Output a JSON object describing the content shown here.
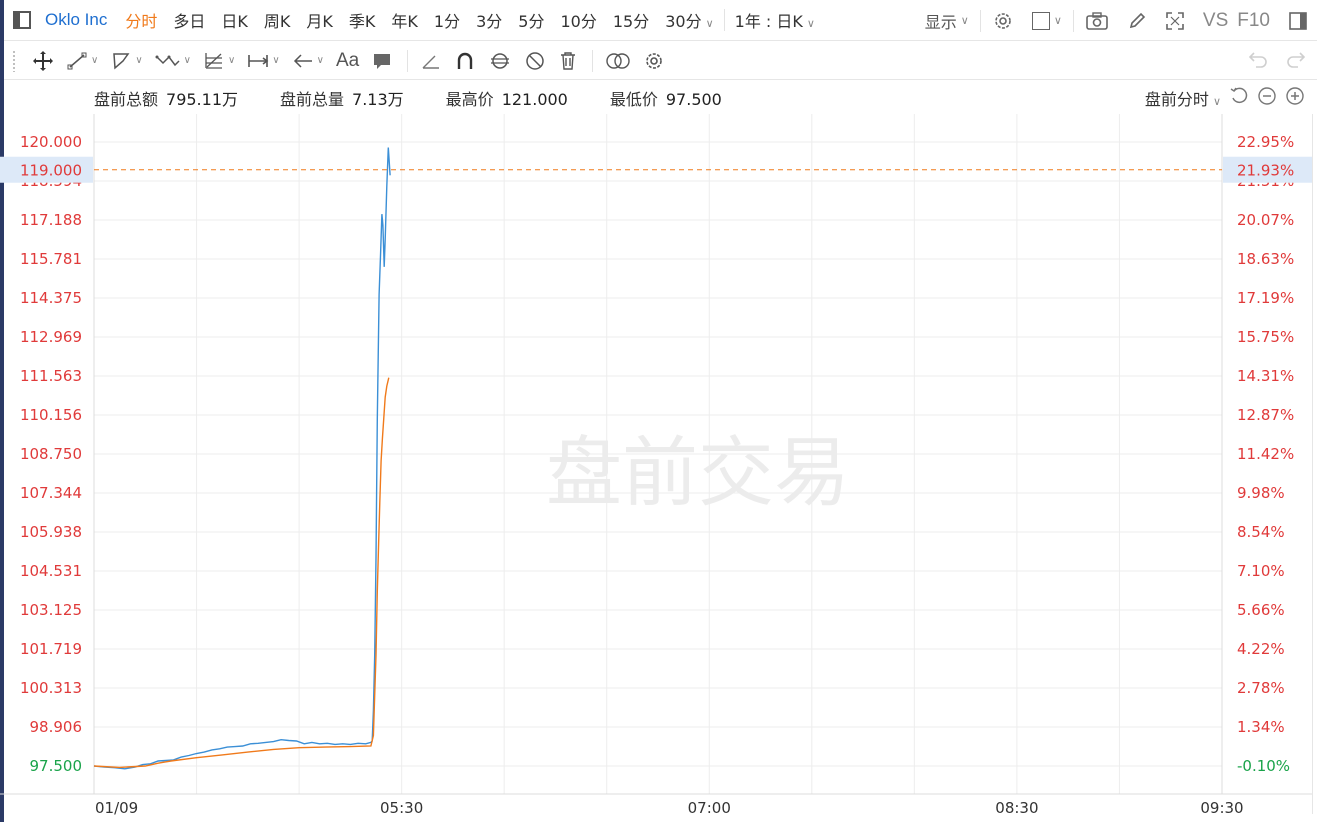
{
  "header": {
    "symbol": "Oklo Inc",
    "timeframes": [
      {
        "label": "分时",
        "active": true
      },
      {
        "label": "多日",
        "active": false
      },
      {
        "label": "日K",
        "active": false
      },
      {
        "label": "周K",
        "active": false
      },
      {
        "label": "月K",
        "active": false
      },
      {
        "label": "季K",
        "active": false
      },
      {
        "label": "年K",
        "active": false
      },
      {
        "label": "1分",
        "active": false
      },
      {
        "label": "3分",
        "active": false
      },
      {
        "label": "5分",
        "active": false
      },
      {
        "label": "10分",
        "active": false
      },
      {
        "label": "15分",
        "active": false
      }
    ],
    "dropdown_interval": "30分",
    "period_select": "1年 : 日K",
    "display_label": "显示",
    "vs_label": "VS",
    "f10_label": "F10"
  },
  "drawing_toolbar": {
    "text_tool": "Aa"
  },
  "stats": {
    "premarket_amount_label": "盘前总额",
    "premarket_amount": "795.11万",
    "premarket_volume_label": "盘前总量",
    "premarket_volume": "7.13万",
    "high_label": "最高价",
    "high": "121.000",
    "low_label": "最低价",
    "low": "97.500",
    "mode_select": "盘前分时"
  },
  "chart_data": {
    "type": "line",
    "watermark": "盘前交易",
    "x_ticks": [
      "01/09",
      "05:30",
      "07:00",
      "08:30",
      "09:30"
    ],
    "left_ticks": [
      "120.000",
      "118.594",
      "117.188",
      "115.781",
      "114.375",
      "112.969",
      "111.563",
      "110.156",
      "108.750",
      "107.344",
      "105.938",
      "104.531",
      "103.125",
      "101.719",
      "100.313",
      "98.906",
      "97.500"
    ],
    "right_ticks": [
      "22.95%",
      "21.51%",
      "20.07%",
      "18.63%",
      "17.19%",
      "15.75%",
      "14.31%",
      "12.87%",
      "11.42%",
      "9.98%",
      "8.54%",
      "7.10%",
      "5.66%",
      "4.22%",
      "2.78%",
      "1.34%",
      "-0.10%"
    ],
    "ylim": [
      97.5,
      120.0
    ],
    "crosshair_price": "119.000",
    "crosshair_pct": "21.93%",
    "crosshair_value": 119.0,
    "colors": {
      "price": "#3b8fd6",
      "average": "#f07a1b",
      "up": "#e03a3a",
      "down": "#1aa34a",
      "crosshair": "#f07a1b",
      "crosshair_bg": "#dde9f8",
      "watermark": "#ececec",
      "grid": "#ededed"
    },
    "series": [
      {
        "role": "price",
        "points": [
          [
            0,
            97.5
          ],
          [
            4,
            97.46
          ],
          [
            8,
            97.44
          ],
          [
            12,
            97.4
          ],
          [
            16,
            97.46
          ],
          [
            19,
            97.55
          ],
          [
            22,
            97.58
          ],
          [
            25,
            97.68
          ],
          [
            28,
            97.7
          ],
          [
            31,
            97.72
          ],
          [
            34,
            97.82
          ],
          [
            37,
            97.88
          ],
          [
            40,
            97.95
          ],
          [
            43,
            98.0
          ],
          [
            46,
            98.08
          ],
          [
            49,
            98.12
          ],
          [
            52,
            98.18
          ],
          [
            55,
            98.2
          ],
          [
            58,
            98.22
          ],
          [
            61,
            98.3
          ],
          [
            64,
            98.32
          ],
          [
            67,
            98.35
          ],
          [
            70,
            98.38
          ],
          [
            73,
            98.45
          ],
          [
            76,
            98.42
          ],
          [
            79,
            98.4
          ],
          [
            82,
            98.3
          ],
          [
            85,
            98.35
          ],
          [
            88,
            98.3
          ],
          [
            91,
            98.32
          ],
          [
            94,
            98.28
          ],
          [
            97,
            98.3
          ],
          [
            100,
            98.28
          ],
          [
            103,
            98.32
          ],
          [
            106,
            98.3
          ],
          [
            108,
            98.35
          ],
          [
            108.5,
            98.4
          ],
          [
            109,
            99.5
          ],
          [
            109.5,
            101.5
          ],
          [
            110,
            105
          ],
          [
            110.5,
            110
          ],
          [
            111.2,
            114.5
          ],
          [
            111.8,
            116
          ],
          [
            112.3,
            117.4
          ],
          [
            112.7,
            117
          ],
          [
            113.2,
            115.5
          ],
          [
            113.6,
            116.5
          ],
          [
            114.2,
            118.4
          ],
          [
            114.8,
            119.8
          ],
          [
            115.5,
            118.8
          ]
        ]
      },
      {
        "role": "average",
        "points": [
          [
            0,
            97.5
          ],
          [
            10,
            97.45
          ],
          [
            20,
            97.5
          ],
          [
            25,
            97.6
          ],
          [
            30,
            97.68
          ],
          [
            40,
            97.8
          ],
          [
            50,
            97.9
          ],
          [
            60,
            98.0
          ],
          [
            70,
            98.1
          ],
          [
            80,
            98.16
          ],
          [
            90,
            98.18
          ],
          [
            100,
            98.2
          ],
          [
            108,
            98.22
          ],
          [
            109,
            98.6
          ],
          [
            110,
            101.5
          ],
          [
            110.5,
            103.8
          ],
          [
            111,
            105.5
          ],
          [
            111.5,
            107
          ],
          [
            112,
            108.5
          ],
          [
            112.5,
            109.3
          ],
          [
            113,
            110
          ],
          [
            113.6,
            110.8
          ],
          [
            114.2,
            111.2
          ],
          [
            115,
            111.5
          ]
        ]
      }
    ]
  }
}
